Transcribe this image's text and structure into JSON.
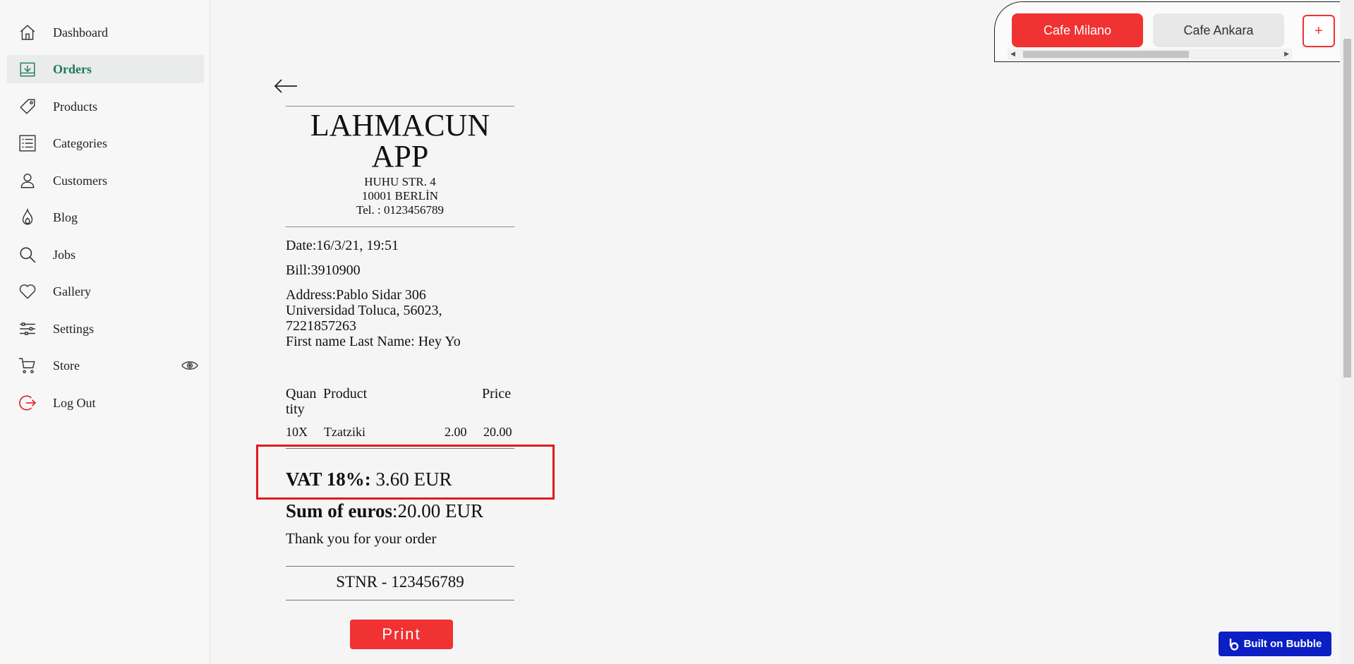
{
  "sidebar": {
    "items": [
      {
        "label": "Dashboard",
        "icon": "home-icon"
      },
      {
        "label": "Orders",
        "icon": "download-tray-icon",
        "active": true
      },
      {
        "label": "Products",
        "icon": "tag-icon"
      },
      {
        "label": "Categories",
        "icon": "list-icon"
      },
      {
        "label": "Customers",
        "icon": "user-icon"
      },
      {
        "label": "Blog",
        "icon": "flame-icon"
      },
      {
        "label": "Jobs",
        "icon": "search-icon"
      },
      {
        "label": "Gallery",
        "icon": "heart-icon"
      },
      {
        "label": "Settings",
        "icon": "sliders-icon"
      },
      {
        "label": "Store",
        "icon": "cart-icon"
      },
      {
        "label": "Log Out",
        "icon": "logout-icon"
      }
    ]
  },
  "tabs": {
    "items": [
      "Cafe Milano",
      "Cafe Ankara"
    ],
    "add_label": "+"
  },
  "receipt": {
    "store_name_line1": "LAHMACUN",
    "store_name_line2": "APP",
    "address_line1": "HUHU STR. 4",
    "address_line2": "10001 BERLİN",
    "phone": "Tel. : 0123456789",
    "date": "Date:16/3/21, 19:51",
    "bill": "Bill:3910900",
    "address1": "Address:Pablo Sidar 306",
    "address2": "Universidad Toluca, 56023,",
    "address3": "7221857263",
    "name": "First name Last Name: Hey Yo",
    "header_qty1": "Quan",
    "header_qty2": "tity",
    "header_product": "Product",
    "header_price": "Price",
    "item_qty": "10X",
    "item_name": "Tzatziki",
    "item_unit": "2.00",
    "item_total": "20.00",
    "vat_label": "VAT 18%:",
    "vat_value": " 3.60 EUR",
    "sum_label": "Sum of euros",
    "sum_value": ":20.00 EUR",
    "thanks": "Thank you for your order",
    "stnr": "STNR - 123456789"
  },
  "print_label": "Print",
  "badge_label": "Built on Bubble",
  "colors": {
    "accent": "#f03232",
    "active_nav": "#1e7a57",
    "badge": "#0b1fc4"
  }
}
